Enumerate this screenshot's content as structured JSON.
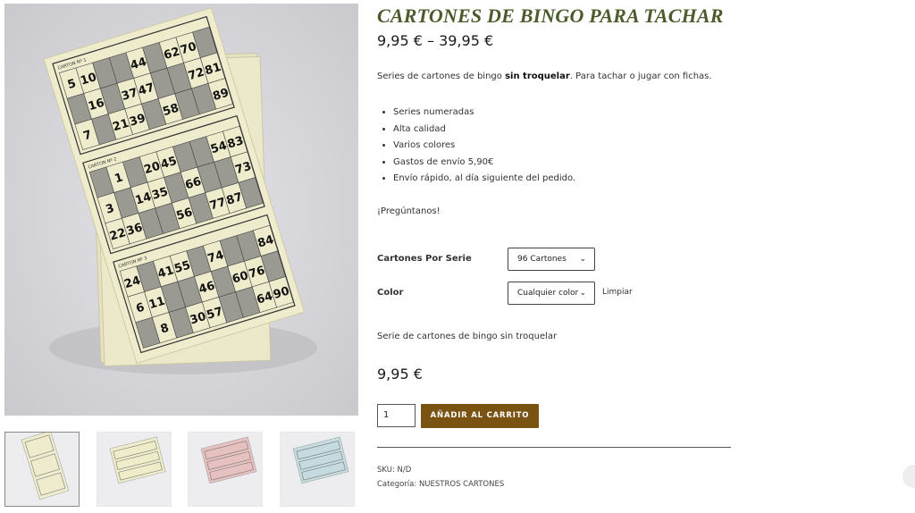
{
  "product": {
    "title": "CARTONES DE BINGO PARA TACHAR",
    "price_range": "9,95 € – 39,95 €",
    "description_before": "Series de cartones de bingo ",
    "description_bold": "sin troquelar",
    "description_after": ". Para tachar o jugar con fichas.",
    "features": [
      "Series numeradas",
      "Alta calidad",
      "Varios colores",
      "Gastos de envío 5,90€",
      "Envío rápido, al día siguiente del pedido."
    ],
    "ask": "¡Pregúntanos!",
    "variation_description": "Serie de cartones de bingo sin troquelar",
    "price": "9,95 €"
  },
  "variations": {
    "cartones_label": "Cartones Por Serie",
    "cartones_value": "96 Cartones",
    "color_label": "Color",
    "color_value": "Cualquier color",
    "clear_label": "Limpiar"
  },
  "cart": {
    "quantity": "1",
    "add_to_cart_label": "AÑADIR AL CARRITO"
  },
  "meta": {
    "sku_label": "SKU:",
    "sku_value": "N/D",
    "category_label": "Categoría:",
    "category_value": "NUESTROS CARTONES"
  },
  "gallery": {
    "card_label": "CARTON Nº",
    "card_rows": [
      [
        "5",
        "10",
        "44",
        "62",
        "70"
      ],
      [
        "16",
        "37",
        "47",
        "72",
        "81"
      ],
      [
        "7",
        "21",
        "39",
        "58",
        "89"
      ],
      [
        "1",
        "20",
        "45",
        "54",
        "83"
      ],
      [
        "3",
        "14",
        "35",
        "66",
        "73"
      ],
      [
        "22",
        "36",
        "56",
        "77",
        "87"
      ],
      [
        "24",
        "41",
        "55",
        "74",
        "84"
      ],
      [
        "6",
        "11",
        "46",
        "60",
        "76"
      ],
      [
        "8",
        "30",
        "57",
        "64",
        "90"
      ]
    ],
    "thumbnails": [
      {
        "name": "thumb-cream-stack",
        "color": "#efeccd",
        "active": true
      },
      {
        "name": "thumb-cream-sheet",
        "color": "#efedc9",
        "active": false
      },
      {
        "name": "thumb-pink",
        "color": "#e7c0c0",
        "active": false
      },
      {
        "name": "thumb-blue",
        "color": "#c5dbe0",
        "active": false
      }
    ]
  },
  "colors": {
    "title": "#4b5b2a",
    "button": "#7a5312",
    "card_paper": "#efeccd",
    "card_cell_dark": "#9a9a92"
  }
}
